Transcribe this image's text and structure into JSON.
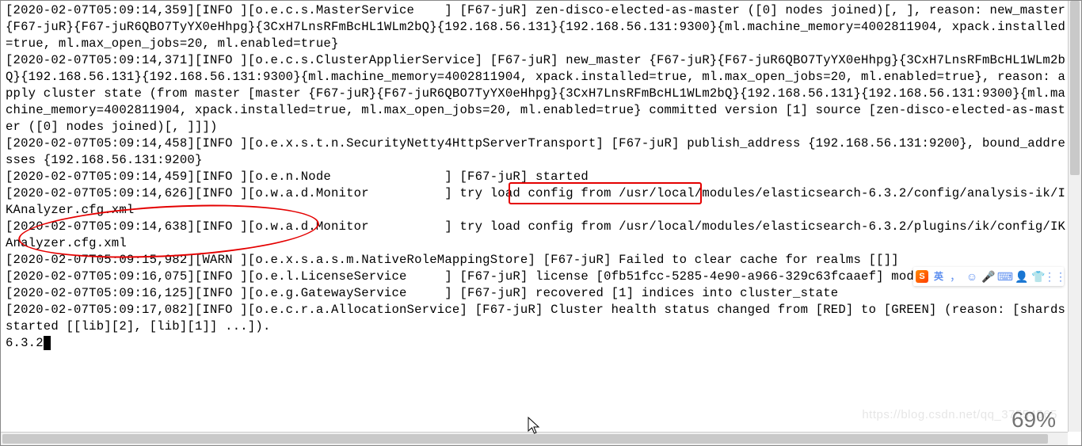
{
  "log_lines": [
    "[2020-02-07T05:09:14,359][INFO ][o.e.c.s.MasterService    ] [F67-juR] zen-disco-elected-as-master ([0] nodes joined)[, ], reason: new_master {F67-juR}{F67-juR6QBO7TyYX0eHhpg}{3CxH7LnsRFmBcHL1WLm2bQ}{192.168.56.131}{192.168.56.131:9300}{ml.machine_memory=4002811904, xpack.installed=true, ml.max_open_jobs=20, ml.enabled=true}",
    "[2020-02-07T05:09:14,371][INFO ][o.e.c.s.ClusterApplierService] [F67-juR] new_master {F67-juR}{F67-juR6QBO7TyYX0eHhpg}{3CxH7LnsRFmBcHL1WLm2bQ}{192.168.56.131}{192.168.56.131:9300}{ml.machine_memory=4002811904, xpack.installed=true, ml.max_open_jobs=20, ml.enabled=true}, reason: apply cluster state (from master [master {F67-juR}{F67-juR6QBO7TyYX0eHhpg}{3CxH7LnsRFmBcHL1WLm2bQ}{192.168.56.131}{192.168.56.131:9300}{ml.machine_memory=4002811904, xpack.installed=true, ml.max_open_jobs=20, ml.enabled=true} committed version [1] source [zen-disco-elected-as-master ([0] nodes joined)[, ]]])",
    "[2020-02-07T05:09:14,458][INFO ][o.e.x.s.t.n.SecurityNetty4HttpServerTransport] [F67-juR] publish_address {192.168.56.131:9200}, bound_addresses {192.168.56.131:9200}",
    "[2020-02-07T05:09:14,459][INFO ][o.e.n.Node               ] [F67-juR] started",
    "[2020-02-07T05:09:14,626][INFO ][o.w.a.d.Monitor          ] try load config from /usr/local/modules/elasticsearch-6.3.2/config/analysis-ik/IKAnalyzer.cfg.xml",
    "[2020-02-07T05:09:14,638][INFO ][o.w.a.d.Monitor          ] try load config from /usr/local/modules/elasticsearch-6.3.2/plugins/ik/config/IKAnalyzer.cfg.xml",
    "[2020-02-07T05:09:15,982][WARN ][o.e.x.s.a.s.m.NativeRoleMappingStore] [F67-juR] Failed to clear cache for realms [[]]",
    "[2020-02-07T05:09:16,075][INFO ][o.e.l.LicenseService     ] [F67-juR] license [0fb51fcc-5285-4e90-a966-329c63fcaaef] mode [basic] - valid",
    "[2020-02-07T05:09:16,125][INFO ][o.e.g.GatewayService     ] [F67-juR] recovered [1] indices into cluster_state",
    "[2020-02-07T05:09:17,082][INFO ][o.e.c.r.a.AllocationService] [F67-juR] Cluster health status changed from [RED] to [GREEN] (reason: [shards started [[lib][2], [lib][1]] ...])."
  ],
  "prompt": "6.3.2",
  "annotations": {
    "rect_label": "started-highlight",
    "ellipse_label": "ikanalyzer-highlight"
  },
  "ime": {
    "logo": "S",
    "lang": "英",
    "icons": [
      "，",
      "☺",
      "🎤",
      "⌨",
      "👤",
      "👕",
      "⋮⋮"
    ]
  },
  "zoom": "69%",
  "watermark": "https://blog.csdn.net/qq_37554565"
}
